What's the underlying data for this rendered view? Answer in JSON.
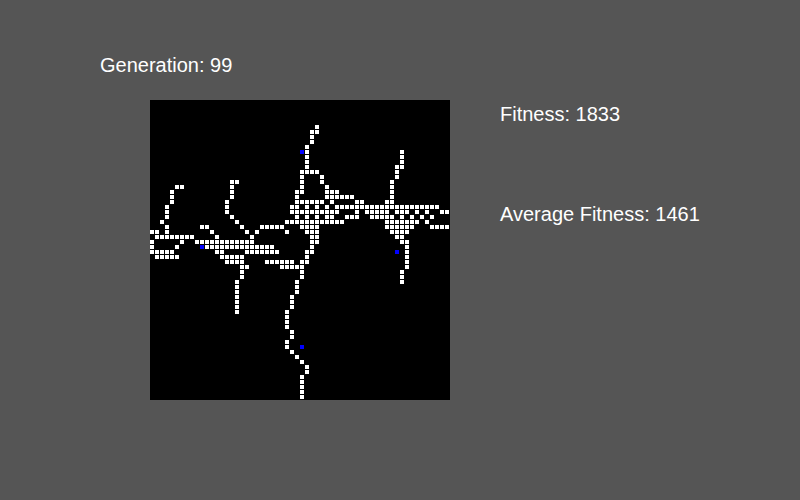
{
  "header": {
    "generation": "Generation: 99"
  },
  "stats": [
    {
      "label": "Fitness: 1833"
    },
    {
      "label": "Average Fitness: 1461"
    }
  ],
  "board": {
    "columns": 60,
    "rows": 60,
    "cells": [
      [
        33,
        5
      ],
      [
        33,
        6
      ],
      [
        32,
        6
      ],
      [
        32,
        7
      ],
      [
        32,
        8
      ],
      [
        31,
        9
      ],
      [
        31,
        10
      ],
      [
        31,
        11
      ],
      [
        31,
        12
      ],
      [
        31,
        13
      ],
      [
        30,
        14
      ],
      [
        31,
        14
      ],
      [
        32,
        14
      ],
      [
        33,
        14
      ],
      [
        34,
        15
      ],
      [
        30,
        15
      ],
      [
        30,
        16
      ],
      [
        34,
        16
      ],
      [
        35,
        17
      ],
      [
        30,
        17
      ],
      [
        35,
        18
      ],
      [
        30,
        18
      ],
      [
        29,
        18
      ],
      [
        29,
        19
      ],
      [
        36,
        18
      ],
      [
        37,
        18
      ],
      [
        29,
        20
      ],
      [
        30,
        20
      ],
      [
        31,
        20
      ],
      [
        32,
        20
      ],
      [
        33,
        20
      ],
      [
        34,
        20
      ],
      [
        28,
        21
      ],
      [
        29,
        21
      ],
      [
        31,
        21
      ],
      [
        33,
        21
      ],
      [
        35,
        21
      ],
      [
        28,
        22
      ],
      [
        29,
        22
      ],
      [
        30,
        22
      ],
      [
        31,
        22
      ],
      [
        32,
        22
      ],
      [
        33,
        22
      ],
      [
        34,
        22
      ],
      [
        35,
        22
      ],
      [
        36,
        22
      ],
      [
        37,
        22
      ],
      [
        29,
        23
      ],
      [
        31,
        23
      ],
      [
        33,
        23
      ],
      [
        35,
        23
      ],
      [
        36,
        23
      ],
      [
        27,
        24
      ],
      [
        28,
        24
      ],
      [
        29,
        24
      ],
      [
        30,
        24
      ],
      [
        31,
        24
      ],
      [
        32,
        24
      ],
      [
        33,
        24
      ],
      [
        34,
        24
      ],
      [
        35,
        24
      ],
      [
        30,
        25
      ],
      [
        31,
        25
      ],
      [
        32,
        25
      ],
      [
        33,
        25
      ],
      [
        31,
        26
      ],
      [
        32,
        26
      ],
      [
        33,
        26
      ],
      [
        32,
        27
      ],
      [
        33,
        27
      ],
      [
        32,
        28
      ],
      [
        33,
        28
      ],
      [
        32,
        29
      ],
      [
        31,
        30
      ],
      [
        32,
        30
      ],
      [
        31,
        31
      ],
      [
        30,
        32
      ],
      [
        31,
        32
      ],
      [
        30,
        33
      ],
      [
        30,
        34
      ],
      [
        30,
        35
      ],
      [
        29,
        36
      ],
      [
        29,
        37
      ],
      [
        29,
        38
      ],
      [
        28,
        39
      ],
      [
        28,
        40
      ],
      [
        28,
        41
      ],
      [
        27,
        42
      ],
      [
        27,
        43
      ],
      [
        27,
        44
      ],
      [
        27,
        45
      ],
      [
        28,
        46
      ],
      [
        28,
        47
      ],
      [
        27,
        48
      ],
      [
        27,
        49
      ],
      [
        28,
        50
      ],
      [
        29,
        51
      ],
      [
        30,
        52
      ],
      [
        31,
        53
      ],
      [
        31,
        54
      ],
      [
        30,
        55
      ],
      [
        30,
        56
      ],
      [
        30,
        57
      ],
      [
        30,
        58
      ],
      [
        30,
        59
      ],
      [
        0,
        26
      ],
      [
        1,
        26
      ],
      [
        1,
        27
      ],
      [
        2,
        27
      ],
      [
        3,
        27
      ],
      [
        4,
        27
      ],
      [
        5,
        27
      ],
      [
        6,
        27
      ],
      [
        7,
        27
      ],
      [
        8,
        27
      ],
      [
        0,
        28
      ],
      [
        6,
        28
      ],
      [
        9,
        28
      ],
      [
        10,
        28
      ],
      [
        11,
        28
      ],
      [
        12,
        28
      ],
      [
        13,
        28
      ],
      [
        14,
        28
      ],
      [
        15,
        28
      ],
      [
        16,
        28
      ],
      [
        17,
        28
      ],
      [
        18,
        28
      ],
      [
        19,
        28
      ],
      [
        20,
        28
      ],
      [
        0,
        29
      ],
      [
        5,
        29
      ],
      [
        11,
        29
      ],
      [
        12,
        29
      ],
      [
        13,
        29
      ],
      [
        14,
        29
      ],
      [
        15,
        29
      ],
      [
        16,
        29
      ],
      [
        17,
        29
      ],
      [
        18,
        29
      ],
      [
        19,
        29
      ],
      [
        20,
        29
      ],
      [
        21,
        29
      ],
      [
        22,
        29
      ],
      [
        23,
        29
      ],
      [
        24,
        29
      ],
      [
        0,
        30
      ],
      [
        1,
        30
      ],
      [
        2,
        30
      ],
      [
        3,
        30
      ],
      [
        4,
        30
      ],
      [
        13,
        30
      ],
      [
        14,
        30
      ],
      [
        19,
        30
      ],
      [
        20,
        30
      ],
      [
        21,
        30
      ],
      [
        22,
        30
      ],
      [
        23,
        30
      ],
      [
        24,
        30
      ],
      [
        25,
        30
      ],
      [
        1,
        31
      ],
      [
        2,
        31
      ],
      [
        3,
        31
      ],
      [
        4,
        31
      ],
      [
        5,
        31
      ],
      [
        14,
        31
      ],
      [
        15,
        31
      ],
      [
        16,
        31
      ],
      [
        17,
        31
      ],
      [
        18,
        31
      ],
      [
        15,
        32
      ],
      [
        16,
        32
      ],
      [
        17,
        32
      ],
      [
        18,
        32
      ],
      [
        23,
        32
      ],
      [
        24,
        32
      ],
      [
        25,
        32
      ],
      [
        26,
        32
      ],
      [
        27,
        32
      ],
      [
        28,
        32
      ],
      [
        18,
        33
      ],
      [
        19,
        33
      ],
      [
        26,
        33
      ],
      [
        27,
        33
      ],
      [
        28,
        33
      ],
      [
        29,
        33
      ],
      [
        5,
        17
      ],
      [
        6,
        17
      ],
      [
        4,
        18
      ],
      [
        4,
        19
      ],
      [
        4,
        20
      ],
      [
        3,
        21
      ],
      [
        3,
        22
      ],
      [
        3,
        23
      ],
      [
        2,
        24
      ],
      [
        3,
        25
      ],
      [
        3,
        26
      ],
      [
        16,
        16
      ],
      [
        17,
        16
      ],
      [
        16,
        17
      ],
      [
        16,
        18
      ],
      [
        16,
        19
      ],
      [
        15,
        20
      ],
      [
        15,
        21
      ],
      [
        15,
        22
      ],
      [
        16,
        23
      ],
      [
        17,
        24
      ],
      [
        18,
        25
      ],
      [
        19,
        26
      ],
      [
        20,
        27
      ],
      [
        21,
        26
      ],
      [
        22,
        25
      ],
      [
        23,
        25
      ],
      [
        24,
        25
      ],
      [
        25,
        25
      ],
      [
        26,
        25
      ],
      [
        27,
        26
      ],
      [
        10,
        25
      ],
      [
        11,
        25
      ],
      [
        12,
        26
      ],
      [
        13,
        27
      ],
      [
        18,
        34
      ],
      [
        18,
        35
      ],
      [
        17,
        36
      ],
      [
        17,
        37
      ],
      [
        17,
        38
      ],
      [
        17,
        39
      ],
      [
        17,
        40
      ],
      [
        17,
        41
      ],
      [
        17,
        42
      ],
      [
        35,
        19
      ],
      [
        36,
        19
      ],
      [
        37,
        19
      ],
      [
        38,
        19
      ],
      [
        39,
        19
      ],
      [
        40,
        19
      ],
      [
        36,
        20
      ],
      [
        41,
        20
      ],
      [
        42,
        20
      ],
      [
        37,
        21
      ],
      [
        38,
        21
      ],
      [
        39,
        21
      ],
      [
        40,
        21
      ],
      [
        41,
        21
      ],
      [
        42,
        21
      ],
      [
        43,
        21
      ],
      [
        44,
        21
      ],
      [
        45,
        21
      ],
      [
        46,
        21
      ],
      [
        47,
        21
      ],
      [
        48,
        21
      ],
      [
        49,
        21
      ],
      [
        50,
        21
      ],
      [
        51,
        21
      ],
      [
        52,
        21
      ],
      [
        53,
        21
      ],
      [
        54,
        21
      ],
      [
        55,
        21
      ],
      [
        56,
        21
      ],
      [
        57,
        21
      ],
      [
        41,
        22
      ],
      [
        43,
        22
      ],
      [
        44,
        22
      ],
      [
        45,
        22
      ],
      [
        46,
        22
      ],
      [
        47,
        22
      ],
      [
        49,
        22
      ],
      [
        50,
        22
      ],
      [
        51,
        22
      ],
      [
        53,
        22
      ],
      [
        55,
        22
      ],
      [
        58,
        22
      ],
      [
        59,
        22
      ],
      [
        39,
        23
      ],
      [
        40,
        23
      ],
      [
        41,
        23
      ],
      [
        44,
        23
      ],
      [
        45,
        23
      ],
      [
        46,
        23
      ],
      [
        47,
        23
      ],
      [
        48,
        23
      ],
      [
        50,
        23
      ],
      [
        52,
        23
      ],
      [
        54,
        23
      ],
      [
        56,
        23
      ],
      [
        36,
        24
      ],
      [
        37,
        24
      ],
      [
        38,
        24
      ],
      [
        47,
        24
      ],
      [
        48,
        24
      ],
      [
        49,
        24
      ],
      [
        50,
        24
      ],
      [
        51,
        24
      ],
      [
        52,
        24
      ],
      [
        53,
        24
      ],
      [
        55,
        24
      ],
      [
        47,
        25
      ],
      [
        48,
        25
      ],
      [
        49,
        25
      ],
      [
        50,
        25
      ],
      [
        51,
        25
      ],
      [
        52,
        25
      ],
      [
        56,
        25
      ],
      [
        57,
        25
      ],
      [
        58,
        25
      ],
      [
        59,
        25
      ],
      [
        48,
        26
      ],
      [
        49,
        26
      ],
      [
        50,
        26
      ],
      [
        51,
        26
      ],
      [
        49,
        27
      ],
      [
        50,
        27
      ],
      [
        50,
        28
      ],
      [
        51,
        28
      ],
      [
        50,
        10
      ],
      [
        50,
        11
      ],
      [
        50,
        12
      ],
      [
        49,
        13
      ],
      [
        50,
        13
      ],
      [
        49,
        14
      ],
      [
        49,
        15
      ],
      [
        48,
        16
      ],
      [
        48,
        17
      ],
      [
        48,
        18
      ],
      [
        48,
        19
      ],
      [
        47,
        20
      ],
      [
        48,
        20
      ],
      [
        51,
        29
      ],
      [
        51,
        30
      ],
      [
        51,
        31
      ],
      [
        51,
        32
      ],
      [
        51,
        33
      ],
      [
        50,
        34
      ],
      [
        50,
        35
      ],
      [
        50,
        36
      ]
    ],
    "agents": [
      [
        30,
        10
      ],
      [
        10,
        29
      ],
      [
        49,
        30
      ],
      [
        30,
        49
      ]
    ]
  }
}
